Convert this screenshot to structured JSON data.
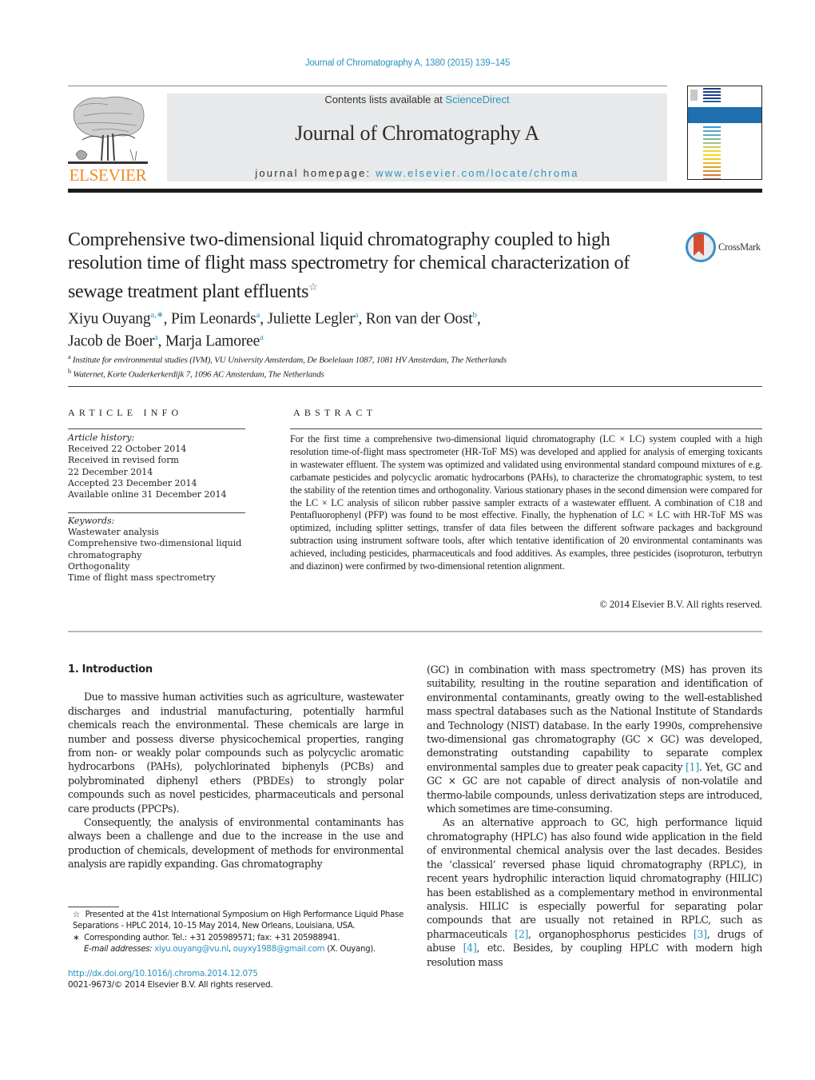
{
  "header": {
    "citation": "Journal of Chromatography A, 1380 (2015) 139–145",
    "contents_prefix": "Contents lists available at ",
    "contents_link": "ScienceDirect",
    "journal_name": "Journal of Chromatography A",
    "homepage_prefix": "journal homepage: ",
    "homepage_link": "www.elsevier.com/locate/chroma",
    "publisher_logo_text": "ELSEVIER",
    "crossmark_label": "CrossMark",
    "colors": {
      "link": "#2a93c0",
      "elsevier_orange": "#f08a24",
      "banner_gray": "#e8e9ea",
      "cover_blue": "#1f6fae",
      "crossmark_red": "#d64c32"
    },
    "cover_stripe_colors": [
      "#1a3f8a",
      "#1a3f8a",
      "#1a3f8a",
      "#1a3f8a",
      "#2a5fa8",
      "#3a9ad0",
      "#4aa6c8",
      "#5fb0b8",
      "#78b8a0",
      "#a2c480",
      "#c8d060",
      "#e6dc30",
      "#f2d81a",
      "#f0c81a",
      "#eab820",
      "#e2a020",
      "#d89030",
      "#d47838",
      "#d66040"
    ]
  },
  "article": {
    "title": "Comprehensive two-dimensional liquid chromatography coupled to high resolution time of flight mass spectrometry for chemical characterization of sewage treatment plant effluents",
    "title_footnote_mark": "☆",
    "authors": [
      {
        "name": "Xiyu Ouyang",
        "sup": "a,∗"
      },
      {
        "name": "Pim Leonards",
        "sup": "a"
      },
      {
        "name": "Juliette Legler",
        "sup": "a"
      },
      {
        "name": "Ron van der Oost",
        "sup": "b"
      },
      {
        "name": "Jacob de Boer",
        "sup": "a"
      },
      {
        "name": "Marja Lamoree",
        "sup": "a"
      }
    ],
    "affiliations": [
      {
        "letter": "a",
        "text": "Institute for environmental studies (IVM), VU University Amsterdam, De Boelelaan 1087, 1081 HV Amsterdam, The Netherlands"
      },
      {
        "letter": "b",
        "text": "Waternet, Korte Ouderkerkerdijk 7, 1096 AC Amsterdam, The Netherlands"
      }
    ]
  },
  "article_info": {
    "heading": "ARTICLE INFO",
    "history_label": "Article history:",
    "history": [
      "Received 22 October 2014",
      "Received in revised form",
      "22 December 2014",
      "Accepted 23 December 2014",
      "Available online 31 December 2014"
    ],
    "keywords_label": "Keywords:",
    "keywords": [
      "Wastewater analysis",
      "Comprehensive two-dimensional liquid",
      "chromatography",
      "Orthogonality",
      "Time of flight mass spectrometry"
    ]
  },
  "abstract": {
    "heading": "ABSTRACT",
    "text": "For the first time a comprehensive two-dimensional liquid chromatography (LC × LC) system coupled with a high resolution time-of-flight mass spectrometer (HR-ToF MS) was developed and applied for analysis of emerging toxicants in wastewater effluent. The system was optimized and validated using environmental standard compound mixtures of e.g. carbamate pesticides and polycyclic aromatic hydrocarbons (PAHs), to characterize the chromatographic system, to test the stability of the retention times and orthogonality. Various stationary phases in the second dimension were compared for the LC × LC analysis of silicon rubber passive sampler extracts of a wastewater effluent. A combination of C18 and Pentafluorophenyl (PFP) was found to be most effective. Finally, the hyphenation of LC × LC with HR-ToF MS was optimized, including splitter settings, transfer of data files between the different software packages and background subtraction using instrument software tools, after which tentative identification of 20 environmental contaminants was achieved, including pesticides, pharmaceuticals and food additives. As examples, three pesticides (isoproturon, terbutryn and diazinon) were confirmed by two-dimensional retention alignment.",
    "copyright": "© 2014 Elsevier B.V. All rights reserved."
  },
  "body": {
    "section_heading": "1.  Introduction",
    "left_paragraphs": [
      "Due to massive human activities such as agriculture, wastewater discharges and industrial manufacturing, potentially harmful chemicals reach the environmental. These chemicals are large in number and possess diverse physicochemical properties, ranging from non- or weakly polar compounds such as polycyclic aromatic hydrocarbons (PAHs), polychlorinated biphenyls (PCBs) and polybrominated diphenyl ethers (PBDEs) to strongly polar compounds such as novel pesticides, pharmaceuticals and personal care products (PPCPs).",
      "Consequently, the analysis of environmental contaminants has always been a challenge and due to the increase in the use and production of chemicals, development of methods for environmental analysis are rapidly expanding. Gas chromatography"
    ],
    "right_p1_a": "(GC) in combination with mass spectrometry (MS) has proven its suitability, resulting in the routine separation and identification of environmental contaminants, greatly owing to the well-established mass spectral databases such as the National Institute of Standards and Technology (NIST) database. In the early 1990s, comprehensive two-dimensional gas chromatography (GC × GC) was developed, demonstrating outstanding capability to separate complex environmental samples due to greater peak capacity ",
    "ref1": "[1]",
    "right_p1_b": ". Yet, GC and GC × GC are not capable of direct analysis of non-volatile and thermo-labile compounds, unless derivatization steps are introduced, which sometimes are time-consuming.",
    "right_p2_a": "As an alternative approach to GC, high performance liquid chromatography (HPLC) has also found wide application in the field of environmental chemical analysis over the last decades. Besides the ‘classical’ reversed phase liquid chromatography (RPLC), in recent years hydrophilic interaction liquid chromatography (HILIC) has been established as a complementary method in environmental analysis. HILIC is especially powerful for separating polar compounds that are usually not retained in RPLC, such as pharmaceuticals ",
    "ref2": "[2]",
    "right_p2_b": ", organophosphorus pesticides ",
    "ref3": "[3]",
    "right_p2_c": ", drugs of abuse ",
    "ref4": "[4]",
    "right_p2_d": ", etc. Besides, by coupling HPLC with modern high resolution mass"
  },
  "footnotes": {
    "star_mark": "☆",
    "star_text": "Presented at the 41st International Symposium on High Performance Liquid Phase Separations - HPLC 2014, 10–15 May 2014, New Orleans, Louisiana, USA.",
    "asterisk_mark": "∗",
    "corresponding_text": "Corresponding author. Tel.: +31 205989571; fax: +31 205988941.",
    "email_label": "E-mail addresses:",
    "email_1": "xiyu.ouyang@vu.nl",
    "email_sep": ", ",
    "email_2": "ouyxy1988@gmail.com",
    "email_suffix": " (X. Ouyang).",
    "doi": "http://dx.doi.org/10.1016/j.chroma.2014.12.075",
    "issn": "0021-9673/© 2014 Elsevier B.V. All rights reserved."
  }
}
